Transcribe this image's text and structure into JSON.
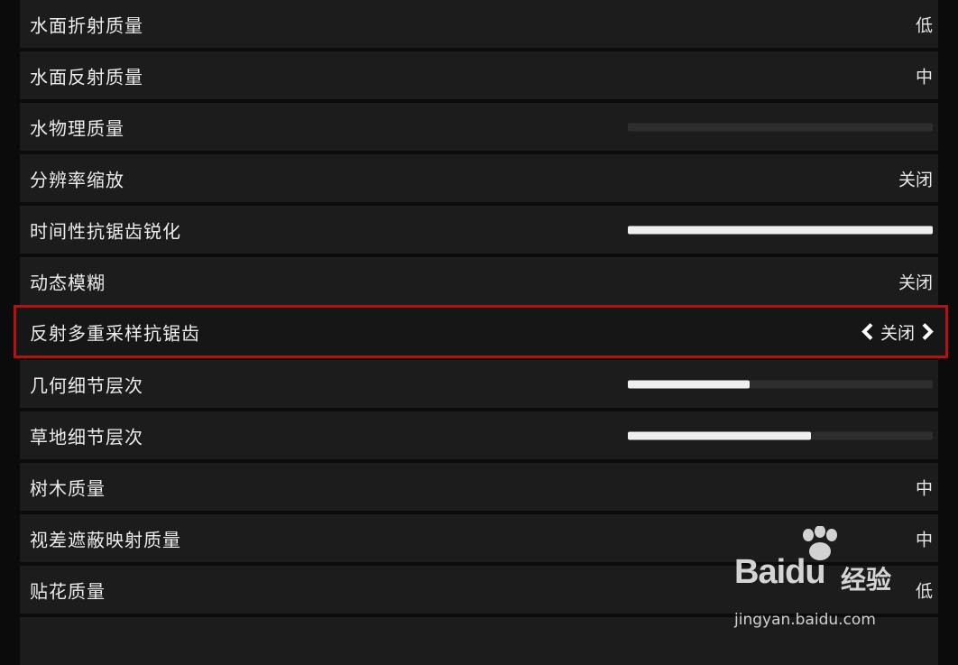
{
  "settings": [
    {
      "label": "水面折射质量",
      "type": "value",
      "value": "低"
    },
    {
      "label": "水面反射质量",
      "type": "value",
      "value": "中"
    },
    {
      "label": "水物理质量",
      "type": "slider",
      "level": 0
    },
    {
      "label": "分辨率缩放",
      "type": "value",
      "value": "关闭"
    },
    {
      "label": "时间性抗锯齿锐化",
      "type": "slider",
      "level": 1.0
    },
    {
      "label": "动态模糊",
      "type": "value",
      "value": "关闭"
    },
    {
      "label": "反射多重采样抗锯齿",
      "type": "selector",
      "value": "关闭",
      "selected": true
    },
    {
      "label": "几何细节层次",
      "type": "slider",
      "level": 0.4
    },
    {
      "label": "草地细节层次",
      "type": "slider",
      "level": 0.6
    },
    {
      "label": "树木质量",
      "type": "value",
      "value": "中"
    },
    {
      "label": "视差遮蔽映射质量",
      "type": "value",
      "value": "中"
    },
    {
      "label": "贴花质量",
      "type": "value",
      "value": "低"
    }
  ],
  "watermark": {
    "brand": "Baidu",
    "brand_cn": "经验",
    "url": "jingyan.baidu.com"
  },
  "colors": {
    "row_bg": "#1c1c1c",
    "highlight": "#b31212",
    "slider_fill": "#efefef",
    "slider_track": "#2e2e2e"
  }
}
